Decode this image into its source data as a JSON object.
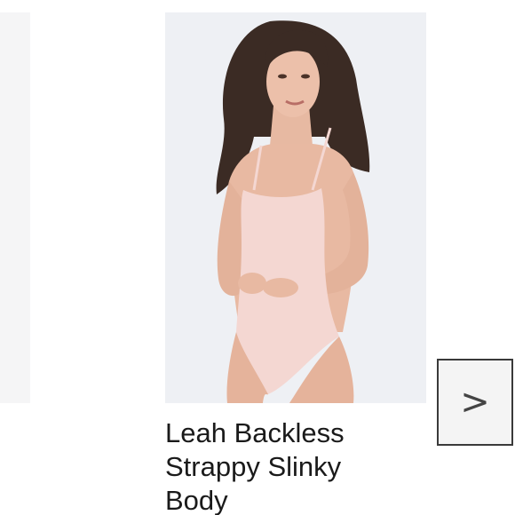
{
  "carousel": {
    "product": {
      "title": "Leah Backless\nStrappy Slinky\nBody",
      "image_alt": "model wearing a pale pink backless strappy bodysuit"
    },
    "next_button": {
      "glyph": ">",
      "icon": "chevron-right-icon"
    }
  },
  "colors": {
    "background": "#ffffff",
    "image_bg": "#eef0f4",
    "side_card": "#f5f5f6",
    "bodysuit": "#f4d7d2",
    "text": "#1a1a1a"
  }
}
